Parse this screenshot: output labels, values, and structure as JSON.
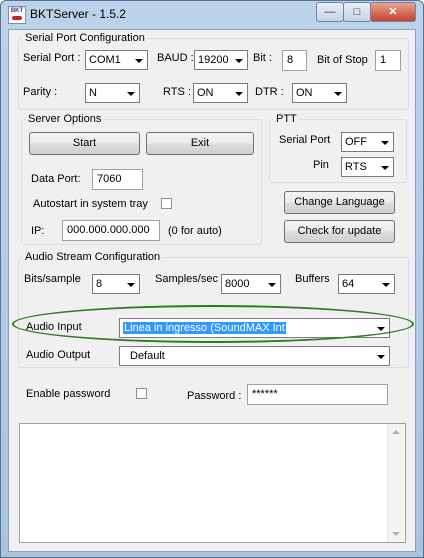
{
  "window": {
    "title": "BKTServer - 1.5.2",
    "icon_text": "BKT"
  },
  "title_buttons": {
    "minimize": "—",
    "maximize": "□",
    "close": "✕"
  },
  "serial": {
    "legend": "Serial Port Configuration",
    "port_label": "Serial Port :",
    "port_value": "COM1",
    "baud_label": "BAUD :",
    "baud_value": "19200",
    "bit_label": "Bit :",
    "bit_value": "8",
    "stop_label": "Bit of Stop",
    "stop_value": "1",
    "parity_label": "Parity :",
    "parity_value": "N",
    "rts_label": "RTS :",
    "rts_value": "ON",
    "dtr_label": "DTR :",
    "dtr_value": "ON"
  },
  "server": {
    "legend": "Server Options",
    "start_label": "Start",
    "exit_label": "Exit",
    "port_label": "Data Port:",
    "port_value": "7060",
    "autostart_label": "Autostart in system tray",
    "ip_label": "IP:",
    "ip_value": "000.000.000.000",
    "ip_hint": "(0 for auto)"
  },
  "ptt": {
    "legend": "PTT",
    "serial_label": "Serial Port",
    "serial_value": "OFF",
    "pin_label": "Pin",
    "pin_value": "RTS"
  },
  "actions": {
    "change_language": "Change Language",
    "check_update": "Check for update"
  },
  "audio": {
    "legend": "Audio Stream Configuration",
    "bits_label": "Bits/sample",
    "bits_value": "8",
    "samples_label": "Samples/sec",
    "samples_value": "8000",
    "buffers_label": "Buffers",
    "buffers_value": "64",
    "input_label": "Audio Input",
    "input_value": "Linea in ingresso (SoundMAX Int",
    "output_label": "Audio Output",
    "output_value": "Default"
  },
  "security": {
    "enable_label": "Enable password",
    "password_label": "Password :",
    "password_value": "******"
  },
  "colors": {
    "highlight_ellipse": "#2e7d22",
    "selection": "#3399ff"
  }
}
